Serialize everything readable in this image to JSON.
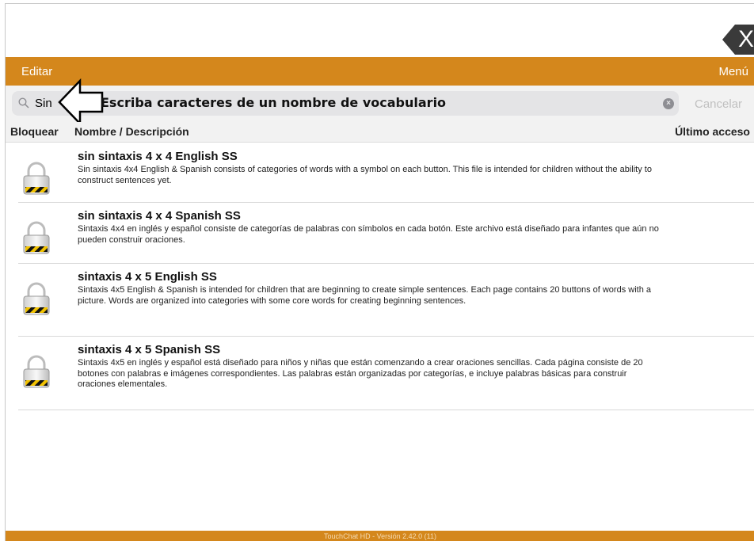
{
  "close_button": {
    "label": "X"
  },
  "toolbar": {
    "edit_label": "Editar",
    "menu_label": "Menú"
  },
  "search": {
    "value": "Sin",
    "cancel_label": "Cancelar",
    "clear_icon": "clear-icon"
  },
  "hint": {
    "text": "Escriba caracteres de un nombre de vocabulario"
  },
  "columns": {
    "lock": "Bloquear",
    "name": "Nombre / Descripción",
    "last_access": "Último acceso"
  },
  "items": [
    {
      "title": "sin sintaxis 4 x 4 English SS",
      "description": "Sin sintaxis 4x4 English & Spanish consists of categories of words with a symbol on each button.  This file is intended for children without the ability to construct sentences yet."
    },
    {
      "title": "sin sintaxis 4 x 4 Spanish SS",
      "description": "Sintaxis 4x4 en inglés y español consiste de categorías de palabras con símbolos en cada botón. Este archivo está diseñado para infantes que aún no pueden construir oraciones."
    },
    {
      "title": "sintaxis 4 x 5 English SS",
      "description": "Sintaxis 4x5 English & Spanish is intended for children that are beginning to create simple sentences.  Each page contains 20 buttons of words with a picture.  Words are organized into categories with some core words for creating beginning sentences."
    },
    {
      "title": "sintaxis 4 x 5 Spanish SS",
      "description": "Sintaxis 4x5 en inglés y español está diseñado para niños y niñas que están comenzando a crear oraciones sencillas. Cada página consiste de 20 botones con palabras e imágenes correspondientes. Las palabras están organizadas por categorías, e incluye palabras básicas para construir oraciones elementales."
    }
  ],
  "footer": {
    "version": "TouchChat HD - Versión 2.42.0 (11)"
  },
  "colors": {
    "accent": "#d4871c",
    "close_bg": "#3a3a3a"
  }
}
